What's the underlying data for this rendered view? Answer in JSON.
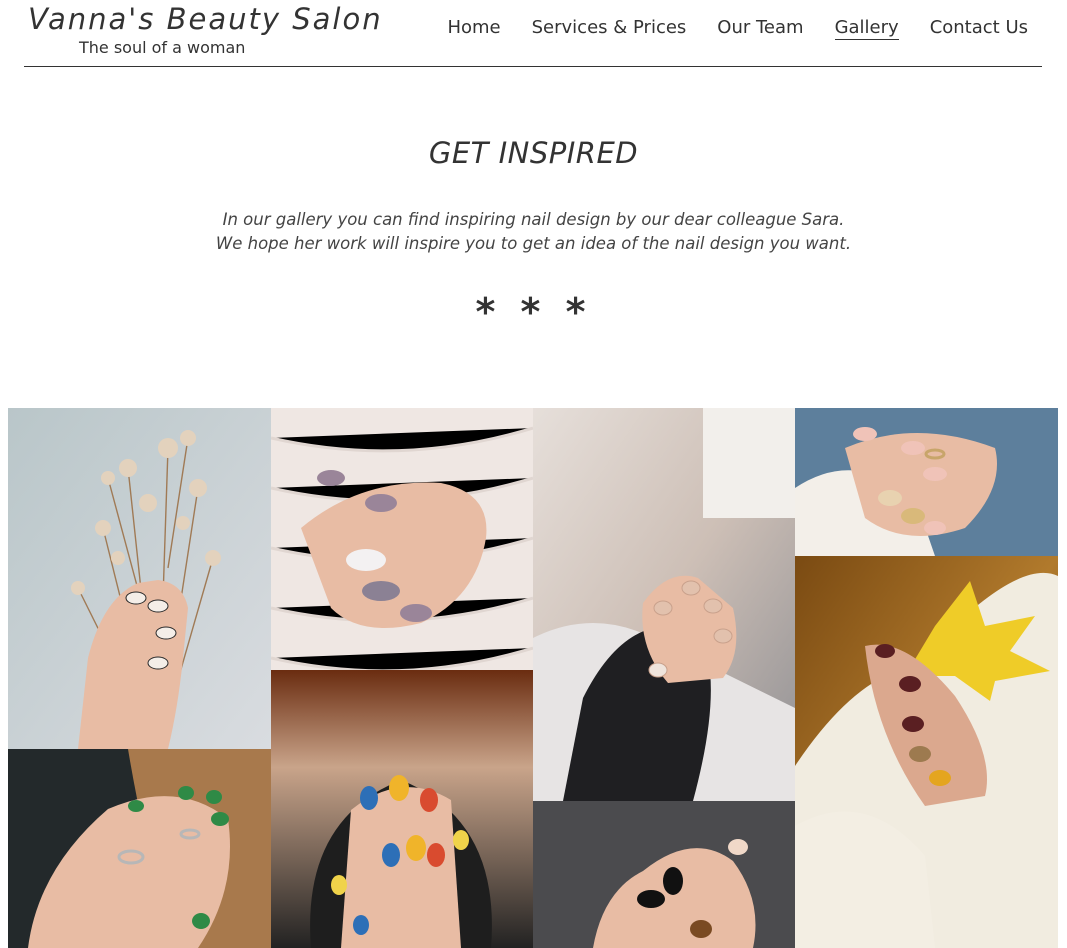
{
  "header": {
    "brand_title": "Vanna's Beauty Salon",
    "brand_tagline": "The soul of a woman"
  },
  "nav": {
    "items": [
      {
        "label": "Home",
        "active": false
      },
      {
        "label": "Services & Prices",
        "active": false
      },
      {
        "label": "Our Team",
        "active": false
      },
      {
        "label": "Gallery",
        "active": true
      },
      {
        "label": "Contact Us",
        "active": false
      }
    ]
  },
  "intro": {
    "heading": "GET INSPIRED",
    "line1": "In our gallery you can find inspiring nail design by our dear colleague Sara.",
    "line2": "We hope her work will inspire you to get an idea of the nail design you want.",
    "divider": "* * *"
  },
  "gallery": {
    "photos": [
      {
        "subject": "hand holding dried flowers"
      },
      {
        "subject": "hand on white knit with lilac and glitter nails"
      },
      {
        "subject": "hand in black sweater with nude nails"
      },
      {
        "subject": "hand with ring and gold foil nails"
      },
      {
        "subject": "hand with green nails and rings"
      },
      {
        "subject": "hands with colorful abstract nails"
      },
      {
        "subject": "hand with black and tortoise nails"
      },
      {
        "subject": "hand with yellow leaf and dark autumn nails"
      }
    ]
  },
  "colors": {
    "text": "#333333",
    "background": "#ffffff"
  }
}
